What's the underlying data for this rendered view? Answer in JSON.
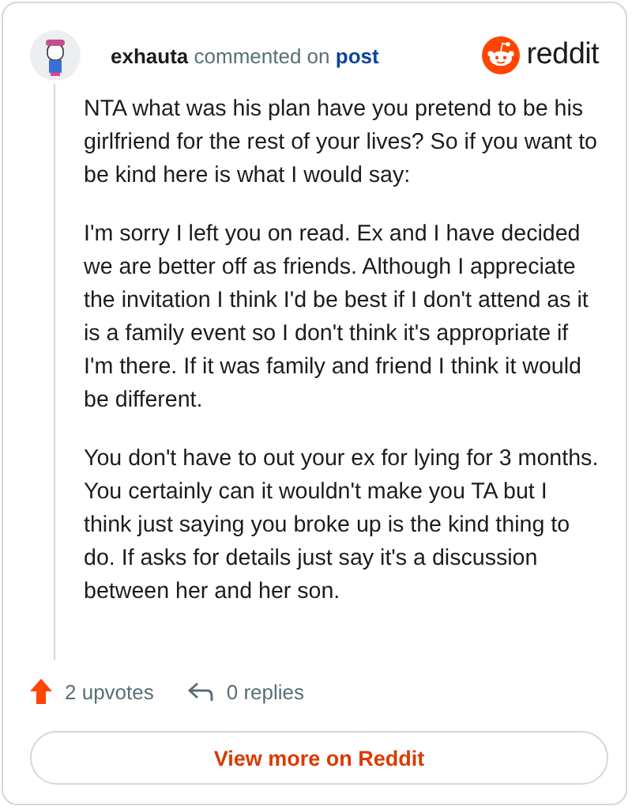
{
  "header": {
    "author": "exhauta",
    "action": "commented on",
    "link": "post",
    "brand": "reddit"
  },
  "paragraphs": [
    "NTA what was his plan have you pretend to be his girlfriend for the rest of your lives? So if you want to be kind here is what I would say:",
    "I'm sorry I left you on read. Ex and I have decided we are better off as friends. Although I appreciate the invitation I think I'd be best if I don't attend as it is a family event so I don't think it's appropriate if I'm there. If it was family and friend I think it would be different.",
    "You don't have to out your ex for lying for 3 months. You certainly can it wouldn't make you TA but I think just saying you broke up is the kind thing to do. If asks for details just say it's a discussion between her and her son."
  ],
  "upvotes": "2 upvotes",
  "replies": "0 replies",
  "button": "View more on Reddit"
}
